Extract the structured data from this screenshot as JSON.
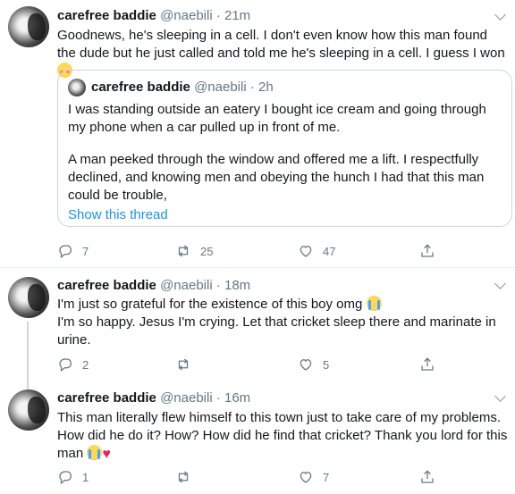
{
  "tweets": [
    {
      "name": "carefree baddie",
      "handle": "@naebili",
      "time": "21m",
      "text_before_emoji": "Goodnews, he's sleeping in a cell. I don't even know how this man found the dude but he just called and told me he's sleeping in a cell. I guess I won ",
      "emoji": "smiling-face-with-blush-emoji",
      "quote": {
        "name": "carefree baddie",
        "handle": "@naebili",
        "time": "2h",
        "para1": "I was standing outside an eatery I bought ice cream and going through my phone when a car pulled up in front of me.",
        "para2": "A man peeked through the window and offered me a lift. I respectfully declined, and knowing men and obeying the hunch I had that this man could be trouble,",
        "link": "Show this thread"
      },
      "replies": "7",
      "retweets": "25",
      "likes": "47"
    },
    {
      "name": "carefree baddie",
      "handle": "@naebili",
      "time": "18m",
      "line1": "I'm just so grateful for the existence of this boy omg ",
      "line2": "I'm so happy. Jesus I'm crying. Let that cricket sleep there and marinate in urine.",
      "emoji": "loudly-crying-face-emoji",
      "replies": "2",
      "retweets": "",
      "likes": "5"
    },
    {
      "name": "carefree baddie",
      "handle": "@naebili",
      "time": "16m",
      "text": "This man literally flew himself to this town just to take care of my problems. How did he do it? How? How did he find that cricket? Thank you lord for this man ",
      "emojis": [
        "loudly-crying-face-emoji",
        "red-heart-emoji"
      ],
      "replies": "1",
      "retweets": "",
      "likes": "7"
    }
  ],
  "separator": "·",
  "colors": {
    "link": "#1b95e0",
    "muted": "#657786",
    "border": "#ccd6dd",
    "heart": "#e0245e"
  }
}
